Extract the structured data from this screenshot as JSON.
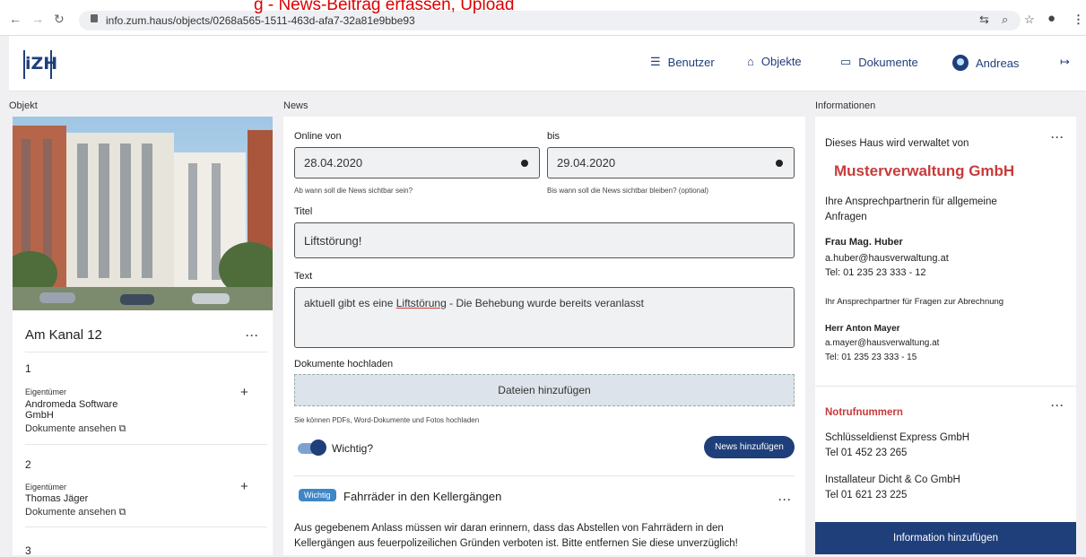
{
  "browser": {
    "url": "info.zum.haus/objects/0268a565-1511-463d-afa7-32a81e9bbe93",
    "annotation": "g - News-Beitrag erfassen, Upload"
  },
  "nav": {
    "logo": "iZH",
    "users": "Benutzer",
    "objects": "Objekte",
    "documents": "Dokumente",
    "user": "Andreas"
  },
  "left": {
    "heading": "Objekt",
    "object_name": "Am Kanal 12",
    "units": [
      {
        "number": "1",
        "role": "Eigentümer",
        "owner_line1": "Andromeda Software",
        "owner_line2": "GmbH",
        "link": "Dokumente ansehen"
      },
      {
        "number": "2",
        "role": "Eigentümer",
        "owner_line1": "Thomas Jäger",
        "owner_line2": "",
        "link": "Dokumente ansehen"
      },
      {
        "number": "3"
      }
    ]
  },
  "news": {
    "heading": "News",
    "online_from_label": "Online von",
    "online_from_value": "28.04.2020",
    "online_from_hint": "Ab wann soll die News sichtbar sein?",
    "until_label": "bis",
    "until_value": "29.04.2020",
    "until_hint": "Bis wann soll die News sichtbar bleiben? (optional)",
    "title_label": "Titel",
    "title_value": "Liftstörung!",
    "text_label": "Text",
    "text_value_prefix": "aktuell gibt es eine ",
    "text_value_link": "Liftstörung",
    "text_value_suffix": " - Die Behebung wurde bereits veranlasst",
    "upload_label": "Dokumente hochladen",
    "upload_button": "Dateien hinzufügen",
    "upload_hint": "Sie können PDFs, Word-Dokumente und Fotos hochladen",
    "important_label": "Wichtig?",
    "important_on": true,
    "submit": "News hinzufügen",
    "item": {
      "badge": "Wichtig",
      "title": "Fahrräder in den Kellergängen",
      "line1": "Aus gegebenem Anlass müssen wir daran erinnern, dass das Abstellen von Fahrrädern in den",
      "line2": "Kellergängen aus feuerpolizeilichen Gründen verboten ist. Bitte entfernen Sie diese unverzüglich!"
    }
  },
  "info": {
    "heading": "Informationen",
    "managed_by": "Dieses Haus wird verwaltet von",
    "company": "Musterverwaltung GmbH",
    "contact_intro_1": "Ihre Ansprechpartnerin für allgemeine",
    "contact_intro_2": "Anfragen",
    "contact1_name": "Frau Mag. Huber",
    "contact1_email": "a.huber@hausverwaltung.at",
    "contact1_tel": "Tel: 01 235 23 333 - 12",
    "contact2_intro": "Ihr Ansprechpartner für Fragen zur Abrechnung",
    "contact2_name": "Herr Anton Mayer",
    "contact2_email": "a.mayer@hausverwaltung.at",
    "contact2_tel": "Tel: 01 235 23 333 - 15",
    "emergency_heading": "Notrufnummern",
    "emergency1_name": "Schlüsseldienst Express GmbH",
    "emergency1_tel": "Tel 01 452 23 265",
    "emergency2_name": "Installateur Dicht & Co GmbH",
    "emergency2_tel": "Tel 01 621 23 225",
    "add_button": "Information hinzufügen"
  },
  "icons": [
    "back-arrow-icon",
    "forward-arrow-icon",
    "reload-icon",
    "lock-icon",
    "translate-icon",
    "zoom-icon",
    "star-icon",
    "account-icon",
    "menu-icon",
    "database-icon",
    "home-icon",
    "archive-icon",
    "avatar",
    "logout-icon",
    "more-dots-icon",
    "plus-icon",
    "external-link-icon",
    "date-clear-icon"
  ],
  "colors": {
    "primary": "#1f3f7a",
    "brand_red": "#c73b3b",
    "badge_blue": "#3f86c6"
  }
}
